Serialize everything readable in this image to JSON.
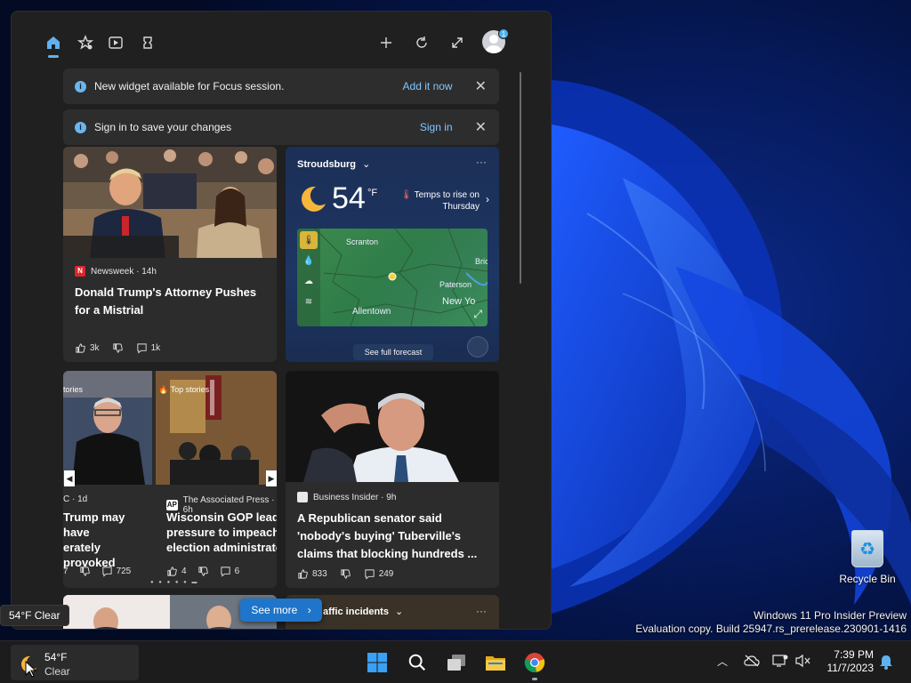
{
  "notices": [
    {
      "message": "New widget available for Focus session.",
      "action": "Add it now"
    },
    {
      "message": "Sign in to save your changes",
      "action": "Sign in"
    }
  ],
  "avatar_badge": "1",
  "cards": {
    "trump": {
      "source": "Newsweek · 14h",
      "source_logo": "N",
      "headline": "Donald Trump's Attorney Pushes for a Mistrial",
      "likes": "3k",
      "comments": "1k"
    },
    "weather": {
      "location": "Stroudsburg",
      "more": "···",
      "temp": "54",
      "unit": "°F",
      "rise_line1": "Temps to rise on",
      "rise_line2": "Thursday",
      "map_labels": [
        "Scranton",
        "Bric",
        "Paterson",
        "New Yo",
        "Allentown"
      ],
      "forecast_button": "See full forecast"
    },
    "carousel": {
      "left_tag": "tories",
      "left_source": "C · 1d",
      "left_headline_1": "Trump may have",
      "left_headline_2": "erately provoked",
      "left_count": "725",
      "left_digit": "7",
      "right_tag": "Top stories",
      "right_source": "The Associated Press · 6h",
      "right_source_logo": "AP",
      "right_headline_1": "Wisconsin GOP leade",
      "right_headline_2": "pressure to impeach s",
      "right_headline_3": "election administrato",
      "right_likes": "4",
      "right_comments": "6"
    },
    "tuberville": {
      "source": "Business Insider · 9h",
      "headline": "A Republican senator said 'nobody's buying' Tuberville's claims that blocking hundreds ...",
      "likes": "833",
      "comments": "249"
    },
    "traffic": {
      "title": "affic incidents",
      "more": "···"
    }
  },
  "see_more": "See more",
  "tooltip": "54°F Clear",
  "desktop": {
    "recycle_bin": "Recycle Bin",
    "watermark_line1": "Windows 11 Pro Insider Preview",
    "watermark_line2": "Evaluation copy. Build 25947.rs_prerelease.230901-1416"
  },
  "taskbar": {
    "weather_temp": "54°F",
    "weather_cond": "Clear",
    "apps": [
      "start-icon",
      "search-icon",
      "task-view-icon",
      "file-explorer-icon",
      "chrome-icon"
    ],
    "time": "7:39 PM",
    "date": "11/7/2023"
  },
  "colors": {
    "accent": "#5fb2f2",
    "panel": "#202020",
    "card": "#2c2c2c",
    "see_more": "#1f75c9"
  }
}
